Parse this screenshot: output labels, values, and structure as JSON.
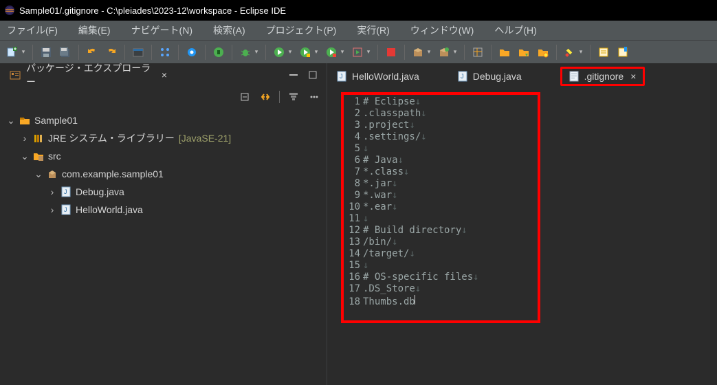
{
  "title": "Sample01/.gitignore - C:\\pleiades\\2023-12\\workspace - Eclipse IDE",
  "menu": {
    "file": "ファイル(F)",
    "edit": "編集(E)",
    "nav": "ナビゲート(N)",
    "search": "検索(A)",
    "project": "プロジェクト(P)",
    "run": "実行(R)",
    "window": "ウィンドウ(W)",
    "help": "ヘルプ(H)"
  },
  "sidebar": {
    "title": "パッケージ・エクスプローラー",
    "project": "Sample01",
    "jre_label": "JRE システム・ライブラリー",
    "jre_ver": "[JavaSE-21]",
    "src": "src",
    "pkg": "com.example.sample01",
    "files": {
      "0": "Debug.java",
      "1": "HelloWorld.java"
    }
  },
  "tabs": {
    "0": "HelloWorld.java",
    "1": "Debug.java",
    "2": ".gitignore"
  },
  "editor": {
    "lines": {
      "1": "# Eclipse",
      "2": ".classpath",
      "3": ".project",
      "4": ".settings/",
      "5": "",
      "6": "# Java",
      "7": "*.class",
      "8": "*.jar",
      "9": "*.war",
      "10": "*.ear",
      "11": "",
      "12": "# Build directory",
      "13": "/bin/",
      "14": "/target/",
      "15": "",
      "16": "# OS-specific files",
      "17": ".DS_Store",
      "18": "Thumbs.db"
    }
  }
}
